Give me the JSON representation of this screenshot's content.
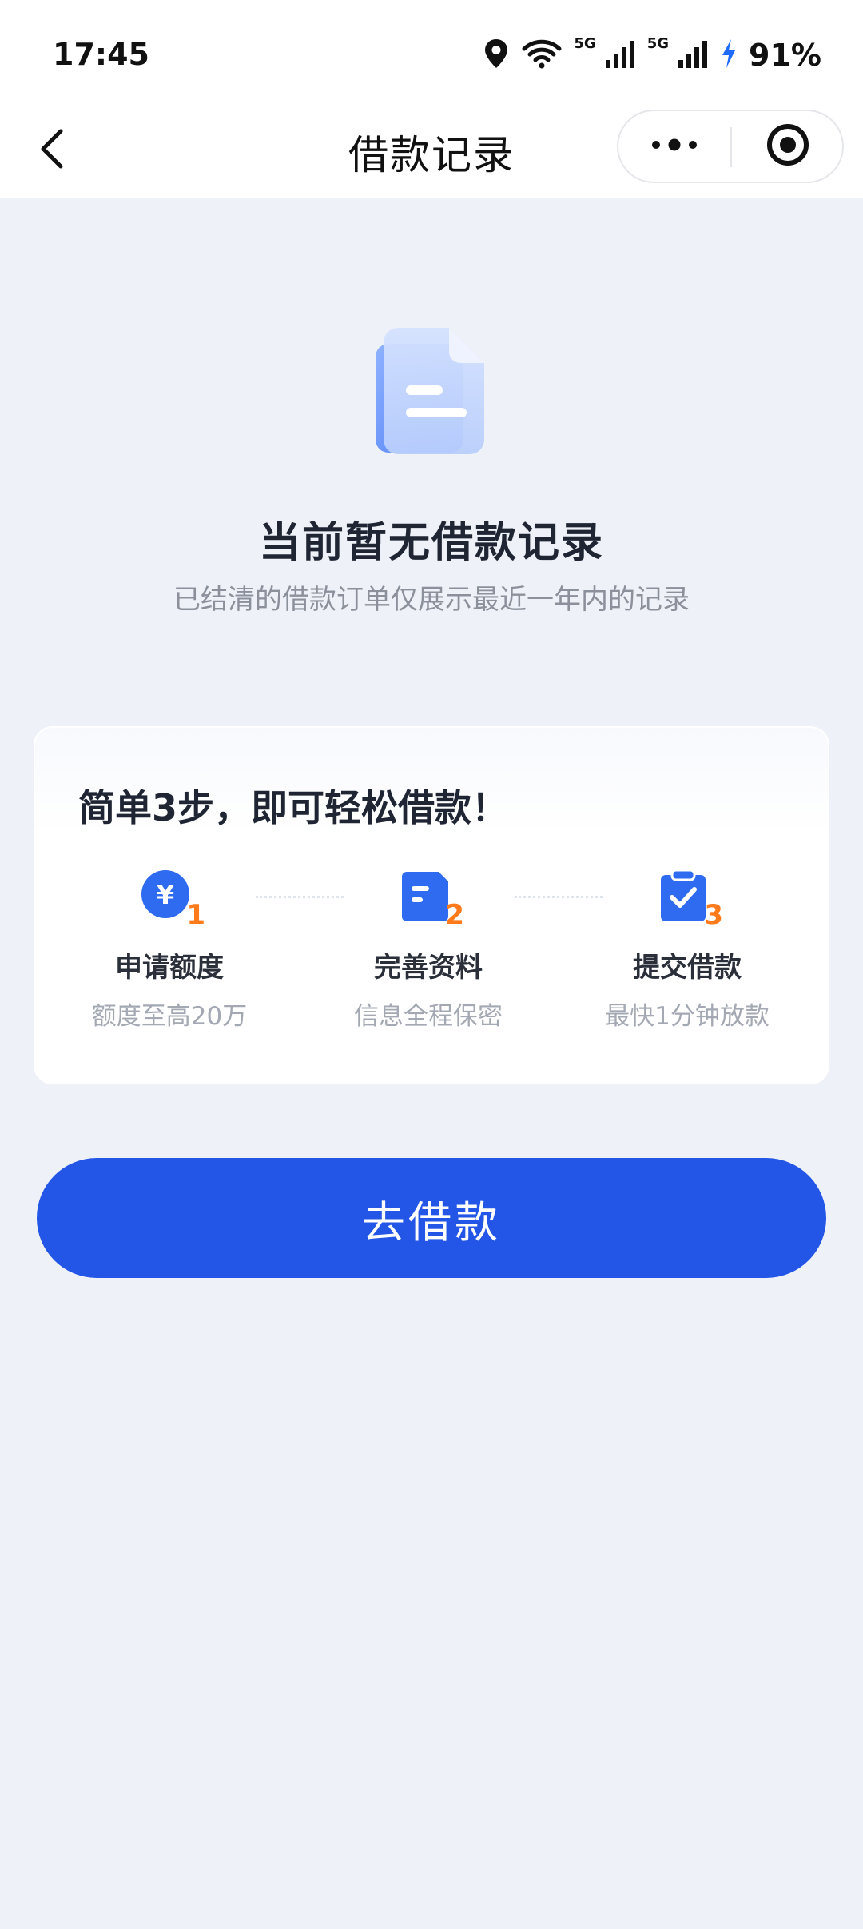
{
  "status_bar": {
    "time": "17:45",
    "signal_1_label": "5G",
    "signal_2_label": "5G",
    "battery": "91%",
    "icons": [
      "location-icon",
      "wifi-icon",
      "signal-icon",
      "signal-icon",
      "charging-icon"
    ]
  },
  "nav": {
    "title": "借款记录",
    "back_icon": "chevron-left-icon",
    "more_icon": "more-dots-icon",
    "close_icon": "target-circle-icon"
  },
  "empty_state": {
    "icon": "document-icon",
    "title": "当前暂无借款记录",
    "subtitle": "已结清的借款订单仅展示最近一年内的记录"
  },
  "steps_card": {
    "title": "简单3步，即可轻松借款！",
    "steps": [
      {
        "number": "1",
        "name": "申请额度",
        "desc": "额度至高20万",
        "icon": "yen-coin-icon"
      },
      {
        "number": "2",
        "name": "完善资料",
        "desc": "信息全程保密",
        "icon": "form-doc-icon"
      },
      {
        "number": "3",
        "name": "提交借款",
        "desc": "最快1分钟放款",
        "icon": "clipboard-check-icon"
      }
    ]
  },
  "cta": {
    "label": "去借款"
  },
  "colors": {
    "primary": "#2356e6",
    "accent_orange": "#ff7a1a",
    "background": "#eef2f8"
  }
}
